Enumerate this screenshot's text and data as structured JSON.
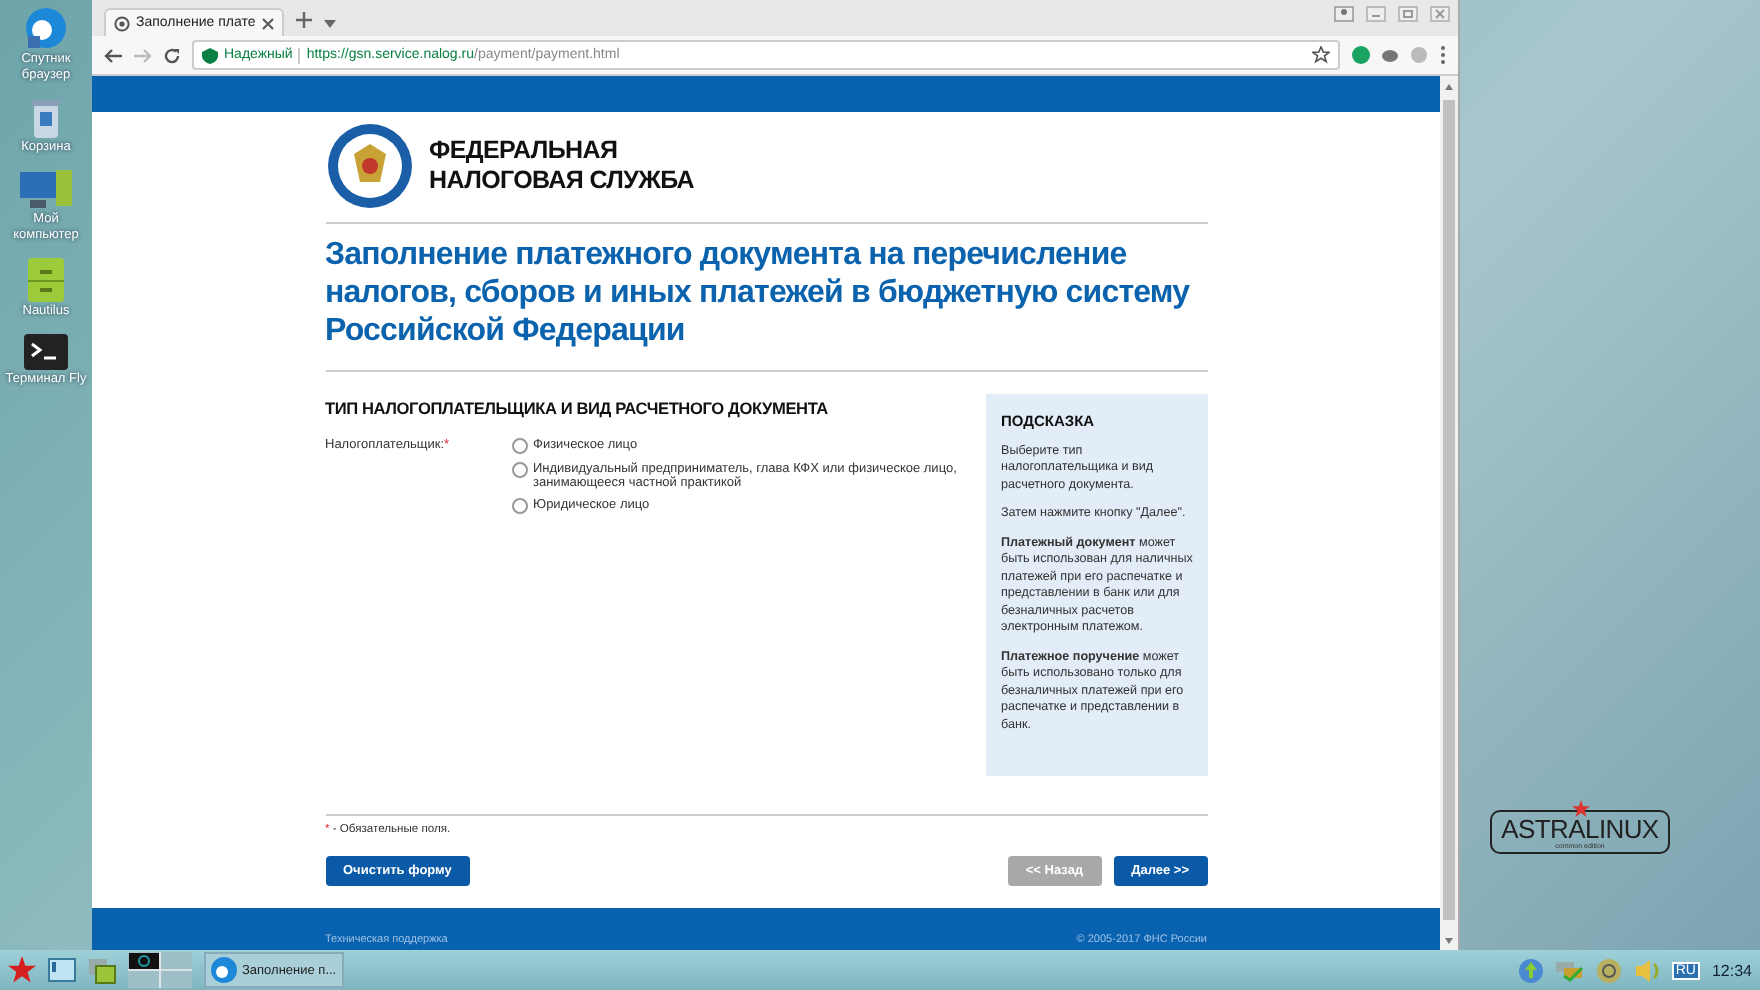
{
  "desktop_icons": [
    {
      "label": "Спутник браузер",
      "kind": "browser"
    },
    {
      "label": "Корзина",
      "kind": "trash"
    },
    {
      "label": "Мой компьютер",
      "kind": "computer"
    },
    {
      "label": "Nautilus",
      "kind": "files"
    },
    {
      "label": "Терминал Fly",
      "kind": "terminal"
    }
  ],
  "browser": {
    "tab_title": "Заполнение плате",
    "secure_label": "Надежный",
    "url_host": "https://gsn.service.nalog.ru",
    "url_path": "/payment/payment.html"
  },
  "page": {
    "logo_lines": [
      "ФЕДЕРАЛЬНАЯ",
      "НАЛОГОВАЯ СЛУЖБА"
    ],
    "title": "Заполнение платежного документа на перечисление налогов, сборов и иных платежей в бюджетную систему Российской Федерации",
    "section_heading": "ТИП НАЛОГОПЛАТЕЛЬЩИКА И ВИД РАСЧЕТНОГО ДОКУМЕНТА",
    "field_label": "Налогоплательщик:",
    "required_mark": "*",
    "options": [
      {
        "label": "Физическое лицо",
        "selected": false
      },
      {
        "label": "Индивидуальный предприниматель, глава КФХ или физическое лицо, занимающееся частной практикой",
        "selected": false
      },
      {
        "label": "Юридическое лицо",
        "selected": false
      }
    ],
    "hint": {
      "title": "ПОДСКАЗКА",
      "paragraphs": [
        "Выберите тип налогоплательщика и вид расчетного документа.",
        "Затем нажмите кнопку \"Далее\".",
        "**Платежный документ** может быть использован для наличных платежей при его распечатке и представлении в банк или для безналичных расчетов электронным платежом.",
        "**Платежное поручение** может быть использовано только для безналичных платежей при его распечатке и представлении в банк."
      ]
    },
    "required_note_mark": "*",
    "required_note": " - Обязательные поля.",
    "buttons": [
      {
        "label": "Очистить форму",
        "disabled": false
      },
      {
        "label": "<< Назад",
        "disabled": true
      },
      {
        "label": "Далее >>",
        "disabled": false
      }
    ],
    "footer_left": "Техническая поддержка",
    "footer_right": "© 2005-2017 ФНС России"
  },
  "logo": {
    "text": "ASTRALINUX",
    "subtitle": "common edition"
  },
  "taskbar": {
    "task": "Заполнение п...",
    "language": "RU",
    "clock": "12:34"
  }
}
